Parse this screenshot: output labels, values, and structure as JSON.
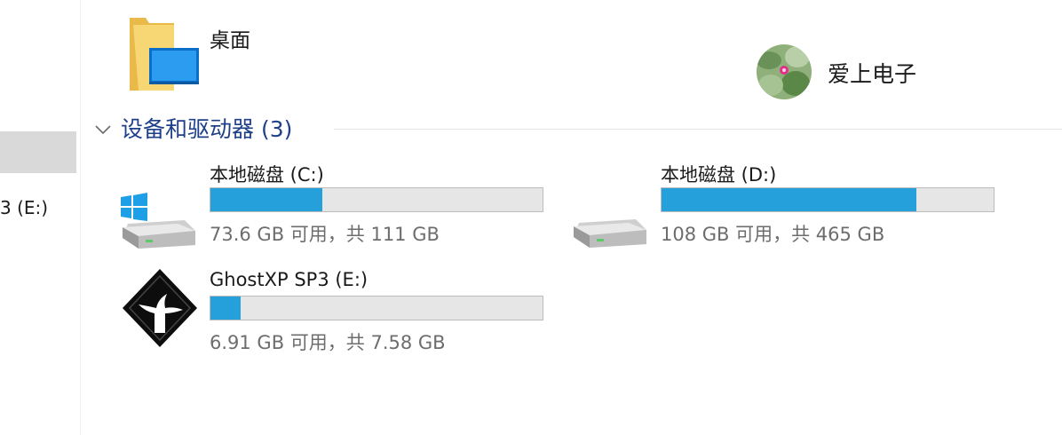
{
  "nav": {
    "partial_label": "3 (E:)"
  },
  "folder": {
    "name": "桌面",
    "icon": "desktop-folder-icon"
  },
  "user": {
    "name": "爱上电子",
    "icon": "user-avatar"
  },
  "group": {
    "title": "设备和驱动器 (3)",
    "icon": "chevron-down-icon"
  },
  "drives": [
    {
      "name": "本地磁盘 (C:)",
      "size_text": "73.6 GB 可用，共 111 GB",
      "used_fraction": 0.337,
      "icon": "windows-drive-icon"
    },
    {
      "name": "本地磁盘 (D:)",
      "size_text": "108 GB 可用，共 465 GB",
      "used_fraction": 0.768,
      "icon": "hard-drive-icon"
    },
    {
      "name": "GhostXP SP3 (E:)",
      "size_text": "6.91 GB 可用，共 7.58 GB",
      "used_fraction": 0.09,
      "icon": "ghost-drive-icon"
    }
  ],
  "colors": {
    "bar_fill": "#26a0da",
    "group_title": "#1e3f8a"
  }
}
